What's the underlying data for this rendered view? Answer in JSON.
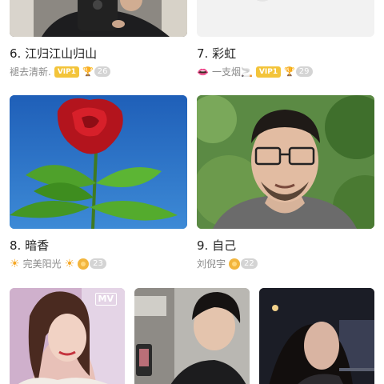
{
  "cards": [
    {
      "title": "6. 江归江山归山",
      "user": "褪去清新.",
      "vip_label": "VIP1",
      "count": "26",
      "thumb_icon": "person-photo"
    },
    {
      "title": "7. 彩虹",
      "user_prefix_icon": "lips-icon",
      "user": "一支烟🚬",
      "vip_label": "VIP1",
      "count": "29",
      "thumb_icon": "loading-placeholder"
    },
    {
      "title": "8. 暗香",
      "user": "完美阳光",
      "count": "23",
      "thumb_icon": "red-rose-photo"
    },
    {
      "title": "9. 自己",
      "user": "刘倪宇",
      "count": "22",
      "thumb_icon": "man-portrait-photo"
    }
  ],
  "bottom_row": [
    {
      "badge": "MV",
      "thumb_icon": "woman-portrait-photo"
    },
    {
      "thumb_icon": "man-selfie-photo"
    },
    {
      "thumb_icon": "woman-night-photo"
    }
  ],
  "colors": {
    "vip": "#f3c43a",
    "count_badge": "#d4d4d4",
    "sky_blue": "#2a72c4"
  }
}
